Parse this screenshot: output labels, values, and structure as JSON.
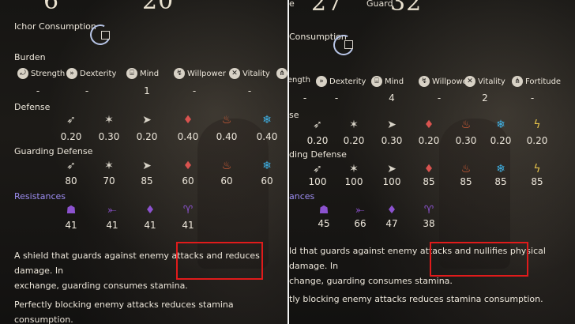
{
  "left": {
    "top_numbers": [
      "6",
      "20"
    ],
    "ichor_label": "Ichor Consumption",
    "burden_label": "Burden",
    "attributes": [
      {
        "icon": "strength-icon",
        "glyph": "⤾",
        "label": "Strength",
        "value": "-"
      },
      {
        "icon": "dexterity-icon",
        "glyph": "»",
        "label": "Dexterity",
        "value": "-"
      },
      {
        "icon": "mind-icon",
        "glyph": "⌸",
        "label": "Mind",
        "value": "1"
      },
      {
        "icon": "willpower-icon",
        "glyph": "↯",
        "label": "Willpower",
        "value": "-"
      },
      {
        "icon": "vitality-icon",
        "glyph": "✕",
        "label": "Vitality",
        "value": "-"
      },
      {
        "icon": "fortitude-icon",
        "glyph": "⋔",
        "label": "",
        "value": ""
      }
    ],
    "defense_label": "Defense",
    "defense": [
      {
        "icon": "physical-icon",
        "glyph": "➶",
        "color": "#d9d4c8",
        "value": "0.20"
      },
      {
        "icon": "strike-icon",
        "glyph": "✶",
        "color": "#d9d4c8",
        "value": "0.30"
      },
      {
        "icon": "pierce-icon",
        "glyph": "➤",
        "color": "#d9d4c8",
        "value": "0.20"
      },
      {
        "icon": "blood-icon",
        "glyph": "♦",
        "color": "#d9534f",
        "value": "0.40"
      },
      {
        "icon": "fire-icon",
        "glyph": "♨",
        "color": "#e0623a",
        "value": "0.40"
      },
      {
        "icon": "frost-icon",
        "glyph": "❄",
        "color": "#3fb3e8",
        "value": "0.40"
      }
    ],
    "guarding_label": "Guarding Defense",
    "guarding": [
      {
        "icon": "physical-icon",
        "glyph": "➶",
        "color": "#d9d4c8",
        "value": "80"
      },
      {
        "icon": "strike-icon",
        "glyph": "✶",
        "color": "#d9d4c8",
        "value": "70"
      },
      {
        "icon": "pierce-icon",
        "glyph": "➤",
        "color": "#d9d4c8",
        "value": "85"
      },
      {
        "icon": "blood-icon",
        "glyph": "♦",
        "color": "#d9534f",
        "value": "60"
      },
      {
        "icon": "fire-icon",
        "glyph": "♨",
        "color": "#e0623a",
        "value": "60"
      },
      {
        "icon": "frost-icon",
        "glyph": "❄",
        "color": "#3fb3e8",
        "value": "60"
      }
    ],
    "resistances_label": "Resistances",
    "resistances": [
      {
        "icon": "resist-a-icon",
        "glyph": "☗",
        "color": "#8c52cf",
        "value": "41"
      },
      {
        "icon": "resist-b-icon",
        "glyph": "⤜",
        "color": "#8c52cf",
        "value": "41"
      },
      {
        "icon": "resist-c-icon",
        "glyph": "♦",
        "color": "#8c52cf",
        "value": "41"
      },
      {
        "icon": "resist-d-icon",
        "glyph": "♈",
        "color": "#8c52cf",
        "value": "41"
      }
    ],
    "desc1_line1": "A shield that guards against enemy attacks and reduces damage. In",
    "desc1_line2": "exchange, guarding consumes stamina.",
    "desc2": "Perfectly blocking enemy attacks reduces stamina consumption."
  },
  "right": {
    "top_label_left": "e",
    "top_number_left": "27",
    "guard_label": "Guard",
    "guard_number": "32",
    "ichor_label": "Consumption",
    "burden_label": "",
    "attributes": [
      {
        "icon": "strength-icon",
        "glyph": "",
        "label": "rength",
        "value": "-"
      },
      {
        "icon": "dexterity-icon",
        "glyph": "»",
        "label": "Dexterity",
        "value": "-"
      },
      {
        "icon": "mind-icon",
        "glyph": "⌸",
        "label": "Mind",
        "value": "4"
      },
      {
        "icon": "willpower-icon",
        "glyph": "↯",
        "label": "Willpower",
        "value": "-"
      },
      {
        "icon": "vitality-icon",
        "glyph": "✕",
        "label": "Vitality",
        "value": "2"
      },
      {
        "icon": "fortitude-icon",
        "glyph": "⋔",
        "label": "Fortitude",
        "value": "-"
      }
    ],
    "defense_label": "se",
    "defense": [
      {
        "icon": "physical-icon",
        "glyph": "➶",
        "color": "#d9d4c8",
        "value": "0.20"
      },
      {
        "icon": "strike-icon",
        "glyph": "✶",
        "color": "#d9d4c8",
        "value": "0.20"
      },
      {
        "icon": "pierce-icon",
        "glyph": "➤",
        "color": "#d9d4c8",
        "value": "0.30"
      },
      {
        "icon": "blood-icon",
        "glyph": "♦",
        "color": "#d9534f",
        "value": "0.20"
      },
      {
        "icon": "fire-icon",
        "glyph": "♨",
        "color": "#e0623a",
        "value": "0.30"
      },
      {
        "icon": "frost-icon",
        "glyph": "❄",
        "color": "#3fb3e8",
        "value": "0.20"
      },
      {
        "icon": "lightning-icon",
        "glyph": "ϟ",
        "color": "#e5c24a",
        "value": "0.20"
      }
    ],
    "guarding_label": "ding Defense",
    "guarding": [
      {
        "icon": "physical-icon",
        "glyph": "➶",
        "color": "#d9d4c8",
        "value": "100"
      },
      {
        "icon": "strike-icon",
        "glyph": "✶",
        "color": "#d9d4c8",
        "value": "100"
      },
      {
        "icon": "pierce-icon",
        "glyph": "➤",
        "color": "#d9d4c8",
        "value": "100"
      },
      {
        "icon": "blood-icon",
        "glyph": "♦",
        "color": "#d9534f",
        "value": "85"
      },
      {
        "icon": "fire-icon",
        "glyph": "♨",
        "color": "#e0623a",
        "value": "85"
      },
      {
        "icon": "frost-icon",
        "glyph": "❄",
        "color": "#3fb3e8",
        "value": "85"
      },
      {
        "icon": "lightning-icon",
        "glyph": "ϟ",
        "color": "#e5c24a",
        "value": "85"
      }
    ],
    "resistances_label": "ances",
    "resistances": [
      {
        "icon": "resist-a-icon",
        "glyph": "☗",
        "color": "#8c52cf",
        "value": "45"
      },
      {
        "icon": "resist-b-icon",
        "glyph": "⤜",
        "color": "#8c52cf",
        "value": "66"
      },
      {
        "icon": "resist-c-icon",
        "glyph": "♦",
        "color": "#8c52cf",
        "value": "47"
      },
      {
        "icon": "resist-d-icon",
        "glyph": "♈",
        "color": "#8c52cf",
        "value": "38"
      }
    ],
    "desc1_line1": "ld that guards against enemy attacks and nullifies physical damage. In",
    "desc1_line2": "change, guarding consumes stamina.",
    "desc2": "tly blocking enemy attacks reduces stamina consumption."
  }
}
